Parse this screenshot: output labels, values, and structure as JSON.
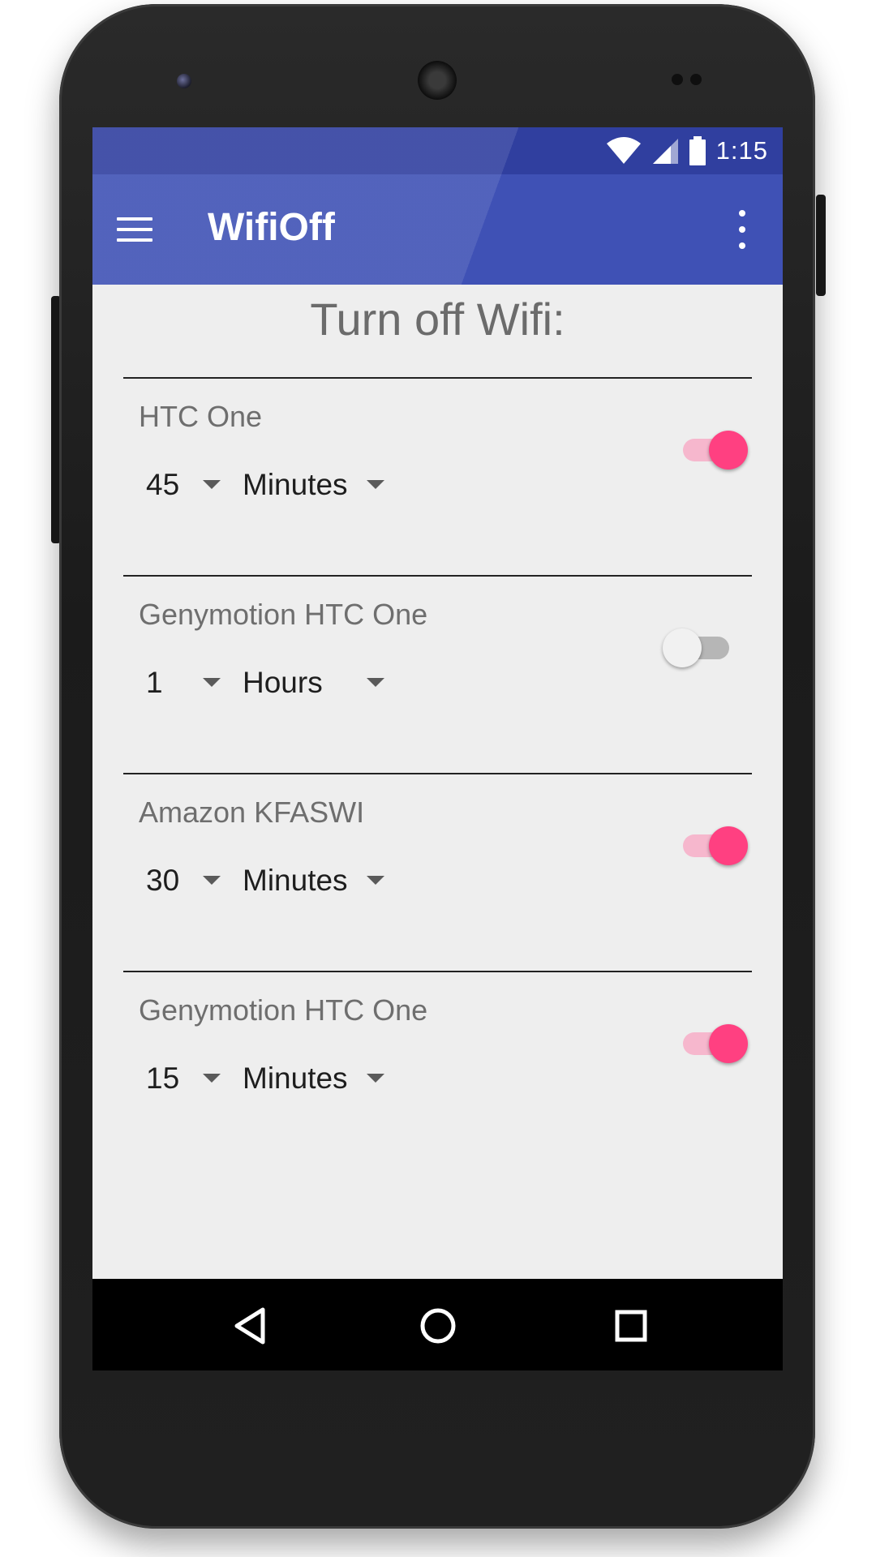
{
  "status_bar": {
    "time": "1:15",
    "icons": [
      "wifi-icon",
      "signal-icon",
      "battery-icon"
    ]
  },
  "app_bar": {
    "title": "WifiOff",
    "menu_icon": "hamburger-menu-icon",
    "overflow_icon": "more-vert-icon"
  },
  "heading": "Turn off Wifi:",
  "devices": [
    {
      "name": "HTC One",
      "amount": "45",
      "unit": "Minutes",
      "enabled": true
    },
    {
      "name": "Genymotion HTC One",
      "amount": "1",
      "unit": "Hours",
      "enabled": false
    },
    {
      "name": "Amazon KFASWI",
      "amount": "30",
      "unit": "Minutes",
      "enabled": true
    },
    {
      "name": "Genymotion HTC One",
      "amount": "15",
      "unit": "Minutes",
      "enabled": true
    }
  ],
  "nav_bar": {
    "buttons": [
      "back-icon",
      "home-icon",
      "recents-icon"
    ]
  },
  "colors": {
    "primary": "#3f51b5",
    "primary_dark": "#303f9f",
    "accent": "#ff4081",
    "background": "#eeeeee"
  }
}
